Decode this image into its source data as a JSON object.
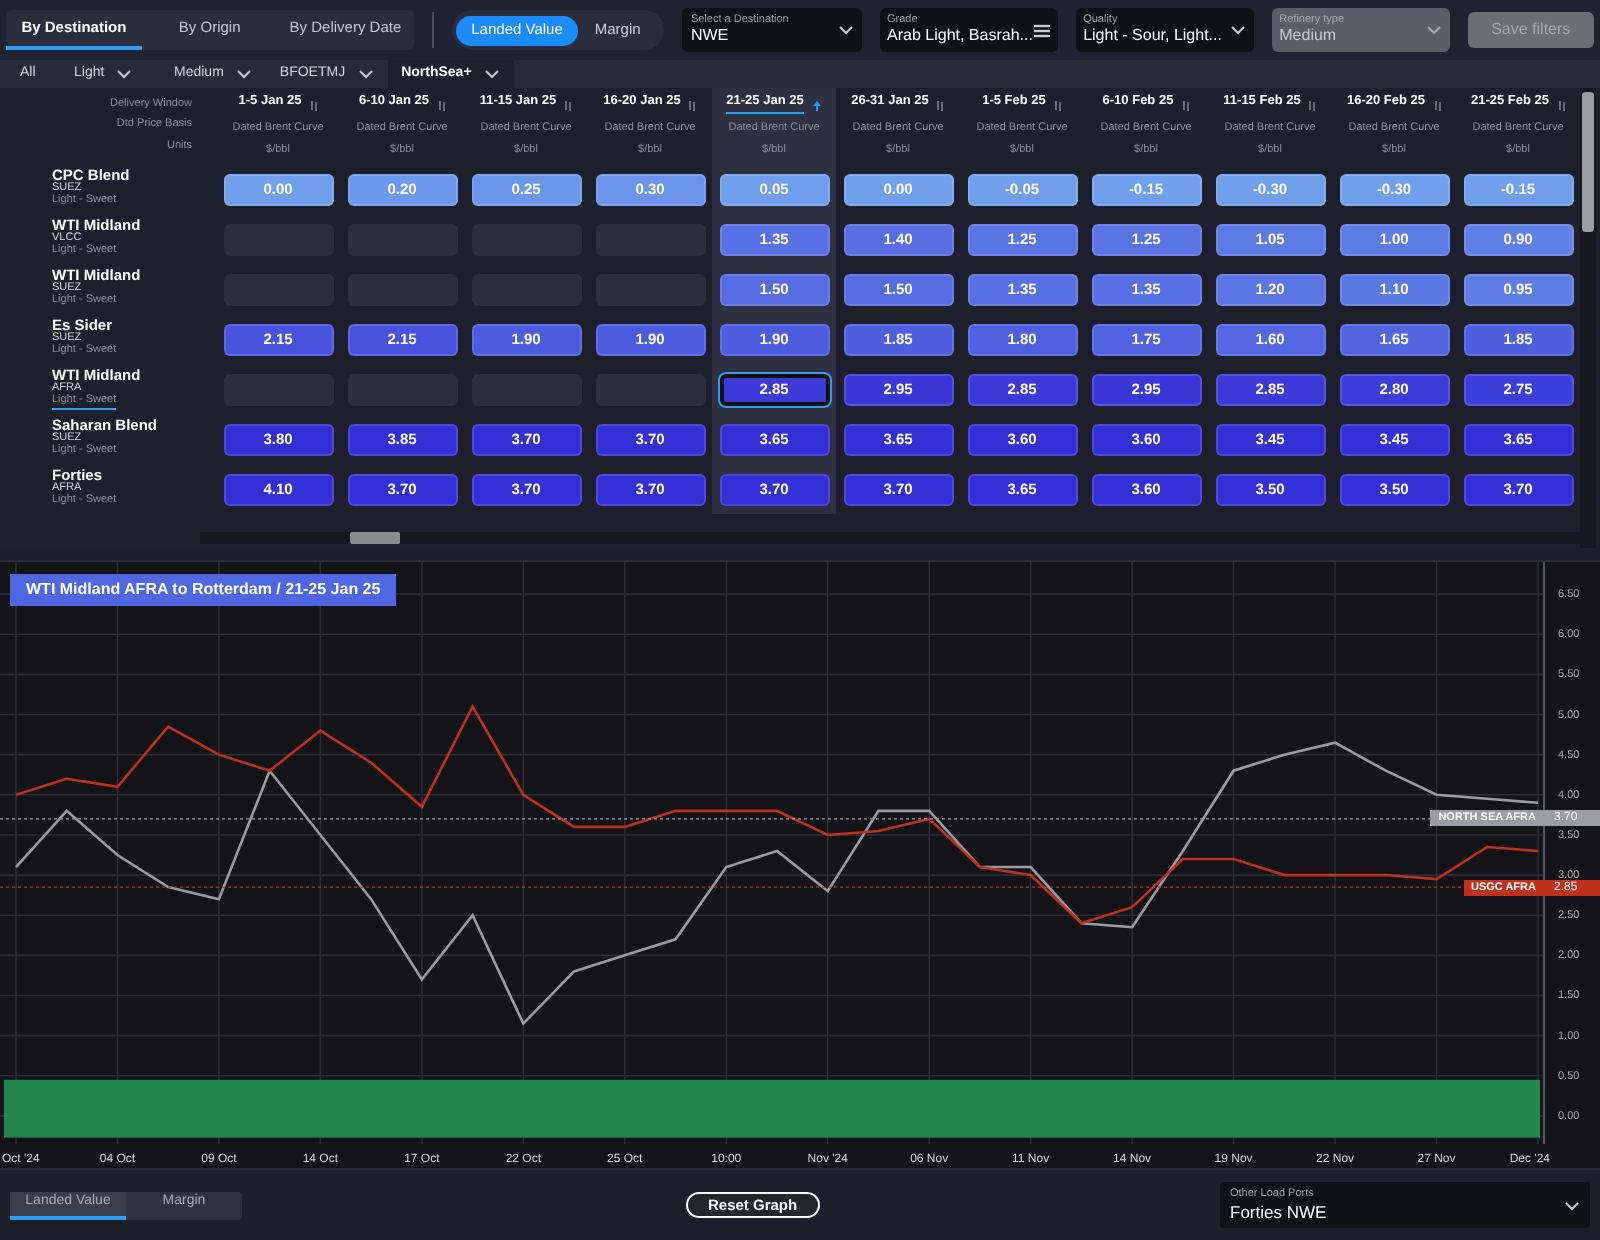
{
  "view_tabs": [
    {
      "label": "By Destination",
      "selected": true
    },
    {
      "label": "By Origin",
      "selected": false
    },
    {
      "label": "By Delivery Date",
      "selected": false
    }
  ],
  "value_toggle": [
    {
      "label": "Landed Value",
      "selected": true
    },
    {
      "label": "Margin",
      "selected": false
    }
  ],
  "filters": [
    {
      "label": "Select a Destination",
      "value": "NWE",
      "kind": "select",
      "disabled": false
    },
    {
      "label": "Grade",
      "value": "Arab Light, Basrah...",
      "kind": "multiselect",
      "disabled": false
    },
    {
      "label": "Quality",
      "value": "Light - Sour, Light...",
      "kind": "select",
      "disabled": false
    },
    {
      "label": "Refinery type",
      "value": "Medium",
      "kind": "select",
      "disabled": true
    }
  ],
  "save_button": {
    "label": "Save filters",
    "disabled": true
  },
  "grade_tabs": [
    {
      "label": "All",
      "dropdown": false,
      "selected": false
    },
    {
      "label": "Light",
      "dropdown": true,
      "selected": false
    },
    {
      "label": "Medium",
      "dropdown": true,
      "selected": false
    },
    {
      "label": "BFOETMJ",
      "dropdown": true,
      "selected": false
    },
    {
      "label": "NorthSea+",
      "dropdown": true,
      "selected": true
    }
  ],
  "grid": {
    "row_headers": [
      "Delivery Window",
      "Dtd Price Basis",
      "Units"
    ],
    "columns": [
      {
        "window": "1-5 Jan 25",
        "basis": "Dated Brent Curve",
        "units": "$/bbl",
        "selected": false
      },
      {
        "window": "6-10 Jan 25",
        "basis": "Dated Brent Curve",
        "units": "$/bbl",
        "selected": false
      },
      {
        "window": "11-15 Jan 25",
        "basis": "Dated Brent Curve",
        "units": "$/bbl",
        "selected": false
      },
      {
        "window": "16-20 Jan 25",
        "basis": "Dated Brent Curve",
        "units": "$/bbl",
        "selected": false
      },
      {
        "window": "21-25 Jan 25",
        "basis": "Dated Brent Curve",
        "units": "$/bbl",
        "selected": true
      },
      {
        "window": "26-31 Jan 25",
        "basis": "Dated Brent Curve",
        "units": "$/bbl",
        "selected": false
      },
      {
        "window": "1-5 Feb 25",
        "basis": "Dated Brent Curve",
        "units": "$/bbl",
        "selected": false
      },
      {
        "window": "6-10 Feb 25",
        "basis": "Dated Brent Curve",
        "units": "$/bbl",
        "selected": false
      },
      {
        "window": "11-15 Feb 25",
        "basis": "Dated Brent Curve",
        "units": "$/bbl",
        "selected": false
      },
      {
        "window": "16-20 Feb 25",
        "basis": "Dated Brent Curve",
        "units": "$/bbl",
        "selected": false
      },
      {
        "window": "21-25 Feb 25",
        "basis": "Dated Brent Curve",
        "units": "$/bbl",
        "selected": false
      }
    ],
    "rows": [
      {
        "grade": "CPC Blend",
        "route": "SUEZ",
        "quality": "Light - Sweet",
        "selected": false,
        "cells": [
          {
            "kind": "price",
            "value": "0.00"
          },
          {
            "kind": "price",
            "value": "0.20"
          },
          {
            "kind": "price",
            "value": "0.25"
          },
          {
            "kind": "price",
            "value": "0.30"
          },
          {
            "kind": "price",
            "value": "0.05"
          },
          {
            "kind": "price",
            "value": "0.00"
          },
          {
            "kind": "price",
            "value": "-0.05"
          },
          {
            "kind": "price",
            "value": "-0.15"
          },
          {
            "kind": "price",
            "value": "-0.30"
          },
          {
            "kind": "price",
            "value": "-0.30"
          },
          {
            "kind": "price",
            "value": "-0.15"
          }
        ]
      },
      {
        "grade": "WTI Midland",
        "route": "VLCC",
        "quality": "Light - Sweet",
        "selected": false,
        "cells": [
          {
            "kind": "empty"
          },
          {
            "kind": "empty"
          },
          {
            "kind": "empty"
          },
          {
            "kind": "empty"
          },
          {
            "kind": "price",
            "value": "1.35"
          },
          {
            "kind": "price",
            "value": "1.40"
          },
          {
            "kind": "price",
            "value": "1.25"
          },
          {
            "kind": "price",
            "value": "1.25"
          },
          {
            "kind": "price",
            "value": "1.05"
          },
          {
            "kind": "price",
            "value": "1.00"
          },
          {
            "kind": "price",
            "value": "0.90"
          }
        ]
      },
      {
        "grade": "WTI Midland",
        "route": "SUEZ",
        "quality": "Light - Sweet",
        "selected": false,
        "cells": [
          {
            "kind": "empty"
          },
          {
            "kind": "empty"
          },
          {
            "kind": "empty"
          },
          {
            "kind": "empty"
          },
          {
            "kind": "price",
            "value": "1.50"
          },
          {
            "kind": "price",
            "value": "1.50"
          },
          {
            "kind": "price",
            "value": "1.35"
          },
          {
            "kind": "price",
            "value": "1.35"
          },
          {
            "kind": "price",
            "value": "1.20"
          },
          {
            "kind": "price",
            "value": "1.10"
          },
          {
            "kind": "price",
            "value": "0.95"
          }
        ]
      },
      {
        "grade": "Es Sider",
        "route": "SUEZ",
        "quality": "Light - Sweet",
        "selected": false,
        "cells": [
          {
            "kind": "price",
            "value": "2.15"
          },
          {
            "kind": "price",
            "value": "2.15"
          },
          {
            "kind": "price",
            "value": "1.90"
          },
          {
            "kind": "price",
            "value": "1.90"
          },
          {
            "kind": "price",
            "value": "1.90"
          },
          {
            "kind": "price",
            "value": "1.85"
          },
          {
            "kind": "price",
            "value": "1.80"
          },
          {
            "kind": "price",
            "value": "1.75"
          },
          {
            "kind": "price",
            "value": "1.60"
          },
          {
            "kind": "price",
            "value": "1.65"
          },
          {
            "kind": "price",
            "value": "1.85"
          }
        ]
      },
      {
        "grade": "WTI Midland",
        "route": "AFRA",
        "quality": "Light - Sweet",
        "selected": true,
        "cells": [
          {
            "kind": "empty"
          },
          {
            "kind": "empty"
          },
          {
            "kind": "empty"
          },
          {
            "kind": "empty"
          },
          {
            "kind": "price",
            "value": "2.85"
          },
          {
            "kind": "price",
            "value": "2.95"
          },
          {
            "kind": "price",
            "value": "2.85"
          },
          {
            "kind": "price",
            "value": "2.95"
          },
          {
            "kind": "price",
            "value": "2.85"
          },
          {
            "kind": "price",
            "value": "2.80"
          },
          {
            "kind": "price",
            "value": "2.75"
          }
        ]
      },
      {
        "grade": "Saharan Blend",
        "route": "SUEZ",
        "quality": "Light - Sweet",
        "selected": false,
        "cells": [
          {
            "kind": "price",
            "value": "3.80"
          },
          {
            "kind": "price",
            "value": "3.85"
          },
          {
            "kind": "price",
            "value": "3.70"
          },
          {
            "kind": "price",
            "value": "3.70"
          },
          {
            "kind": "price",
            "value": "3.65"
          },
          {
            "kind": "price",
            "value": "3.65"
          },
          {
            "kind": "price",
            "value": "3.60"
          },
          {
            "kind": "price",
            "value": "3.60"
          },
          {
            "kind": "price",
            "value": "3.45"
          },
          {
            "kind": "price",
            "value": "3.45"
          },
          {
            "kind": "price",
            "value": "3.65"
          }
        ]
      },
      {
        "grade": "Forties",
        "route": "AFRA",
        "quality": "Light - Sweet",
        "selected": false,
        "cells": [
          {
            "kind": "price",
            "value": "4.10"
          },
          {
            "kind": "price",
            "value": "3.70"
          },
          {
            "kind": "price",
            "value": "3.70"
          },
          {
            "kind": "price",
            "value": "3.70"
          },
          {
            "kind": "price",
            "value": "3.70"
          },
          {
            "kind": "price",
            "value": "3.70"
          },
          {
            "kind": "price",
            "value": "3.65"
          },
          {
            "kind": "price",
            "value": "3.60"
          },
          {
            "kind": "price",
            "value": "3.50"
          },
          {
            "kind": "price",
            "value": "3.50"
          },
          {
            "kind": "price",
            "value": "3.70"
          }
        ]
      }
    ]
  },
  "chart": {
    "title": "WTI Midland AFRA to Rotterdam / 21-25 Jan 25",
    "chart_data": {
      "type": "line",
      "categories": [
        "Oct '24",
        null,
        "04 Oct",
        null,
        "09 Oct",
        null,
        "14 Oct",
        null,
        "17 Oct",
        null,
        "22 Oct",
        null,
        "25 Oct",
        null,
        "10:00",
        null,
        "Nov '24",
        null,
        "06 Nov",
        null,
        "11 Nov",
        null,
        "14 Nov",
        null,
        "19 Nov",
        null,
        "22 Nov",
        null,
        "27 Nov",
        null,
        "Dec '24"
      ],
      "series": [
        {
          "name": "NORTH SEA AFRA",
          "color": "#9a9ba3",
          "values": [
            3.1,
            3.8,
            3.25,
            2.85,
            2.7,
            4.3,
            3.5,
            2.7,
            1.7,
            2.5,
            1.15,
            1.8,
            2.0,
            2.2,
            3.1,
            3.3,
            2.8,
            3.8,
            3.8,
            3.1,
            3.1,
            2.4,
            2.35,
            3.3,
            4.3,
            4.5,
            4.65,
            4.3,
            4.0,
            3.95,
            3.9
          ]
        },
        {
          "name": "USGC AFRA",
          "color": "#c0301f",
          "values": [
            4.0,
            4.2,
            4.1,
            4.85,
            4.5,
            4.3,
            4.8,
            4.4,
            3.85,
            5.1,
            4.0,
            3.6,
            3.6,
            3.8,
            3.8,
            3.8,
            3.5,
            3.55,
            3.7,
            3.1,
            3.0,
            2.4,
            2.6,
            3.2,
            3.2,
            3.0,
            3.0,
            3.0,
            2.95,
            3.35,
            3.3
          ]
        }
      ],
      "ylim": [
        -0.3,
        6.85
      ],
      "grid": true,
      "ref_lines": [
        {
          "axis": "y",
          "value": 3.7,
          "color": "#9a9ba3"
        },
        {
          "axis": "y",
          "value": 2.85,
          "color": "#c0301f"
        }
      ],
      "bands": [
        {
          "axis": "y",
          "from": -0.27,
          "to": 0.45,
          "color": "#23864a"
        }
      ],
      "yticks": [
        {
          "value": 0,
          "label": "0.00"
        },
        {
          "value": 0.5,
          "label": "0.50"
        },
        {
          "value": 1,
          "label": "1.00"
        },
        {
          "value": 1.5,
          "label": "1.50"
        },
        {
          "value": 2,
          "label": "2.00"
        },
        {
          "value": 2.5,
          "label": "2.50"
        },
        {
          "value": 3,
          "label": "3.00"
        },
        {
          "value": 3.5,
          "label": "3.50"
        },
        {
          "value": 4,
          "label": "4.00"
        },
        {
          "value": 4.5,
          "label": "4.50"
        },
        {
          "value": 5,
          "label": "5.00"
        },
        {
          "value": 5.5,
          "label": "5.50"
        },
        {
          "value": 6,
          "label": "6.00"
        },
        {
          "value": 6.5,
          "label": "6.50"
        }
      ]
    },
    "price_tags": [
      {
        "value": "3.70"
      },
      {
        "value": "2.85"
      }
    ]
  },
  "bottom": {
    "mode_tabs": [
      {
        "label": "Landed Value",
        "selected": true
      },
      {
        "label": "Margin",
        "selected": false
      }
    ],
    "reset_button": "Reset Graph",
    "load_ports": {
      "label": "Other Load Ports",
      "value": "Forties NWE"
    }
  }
}
